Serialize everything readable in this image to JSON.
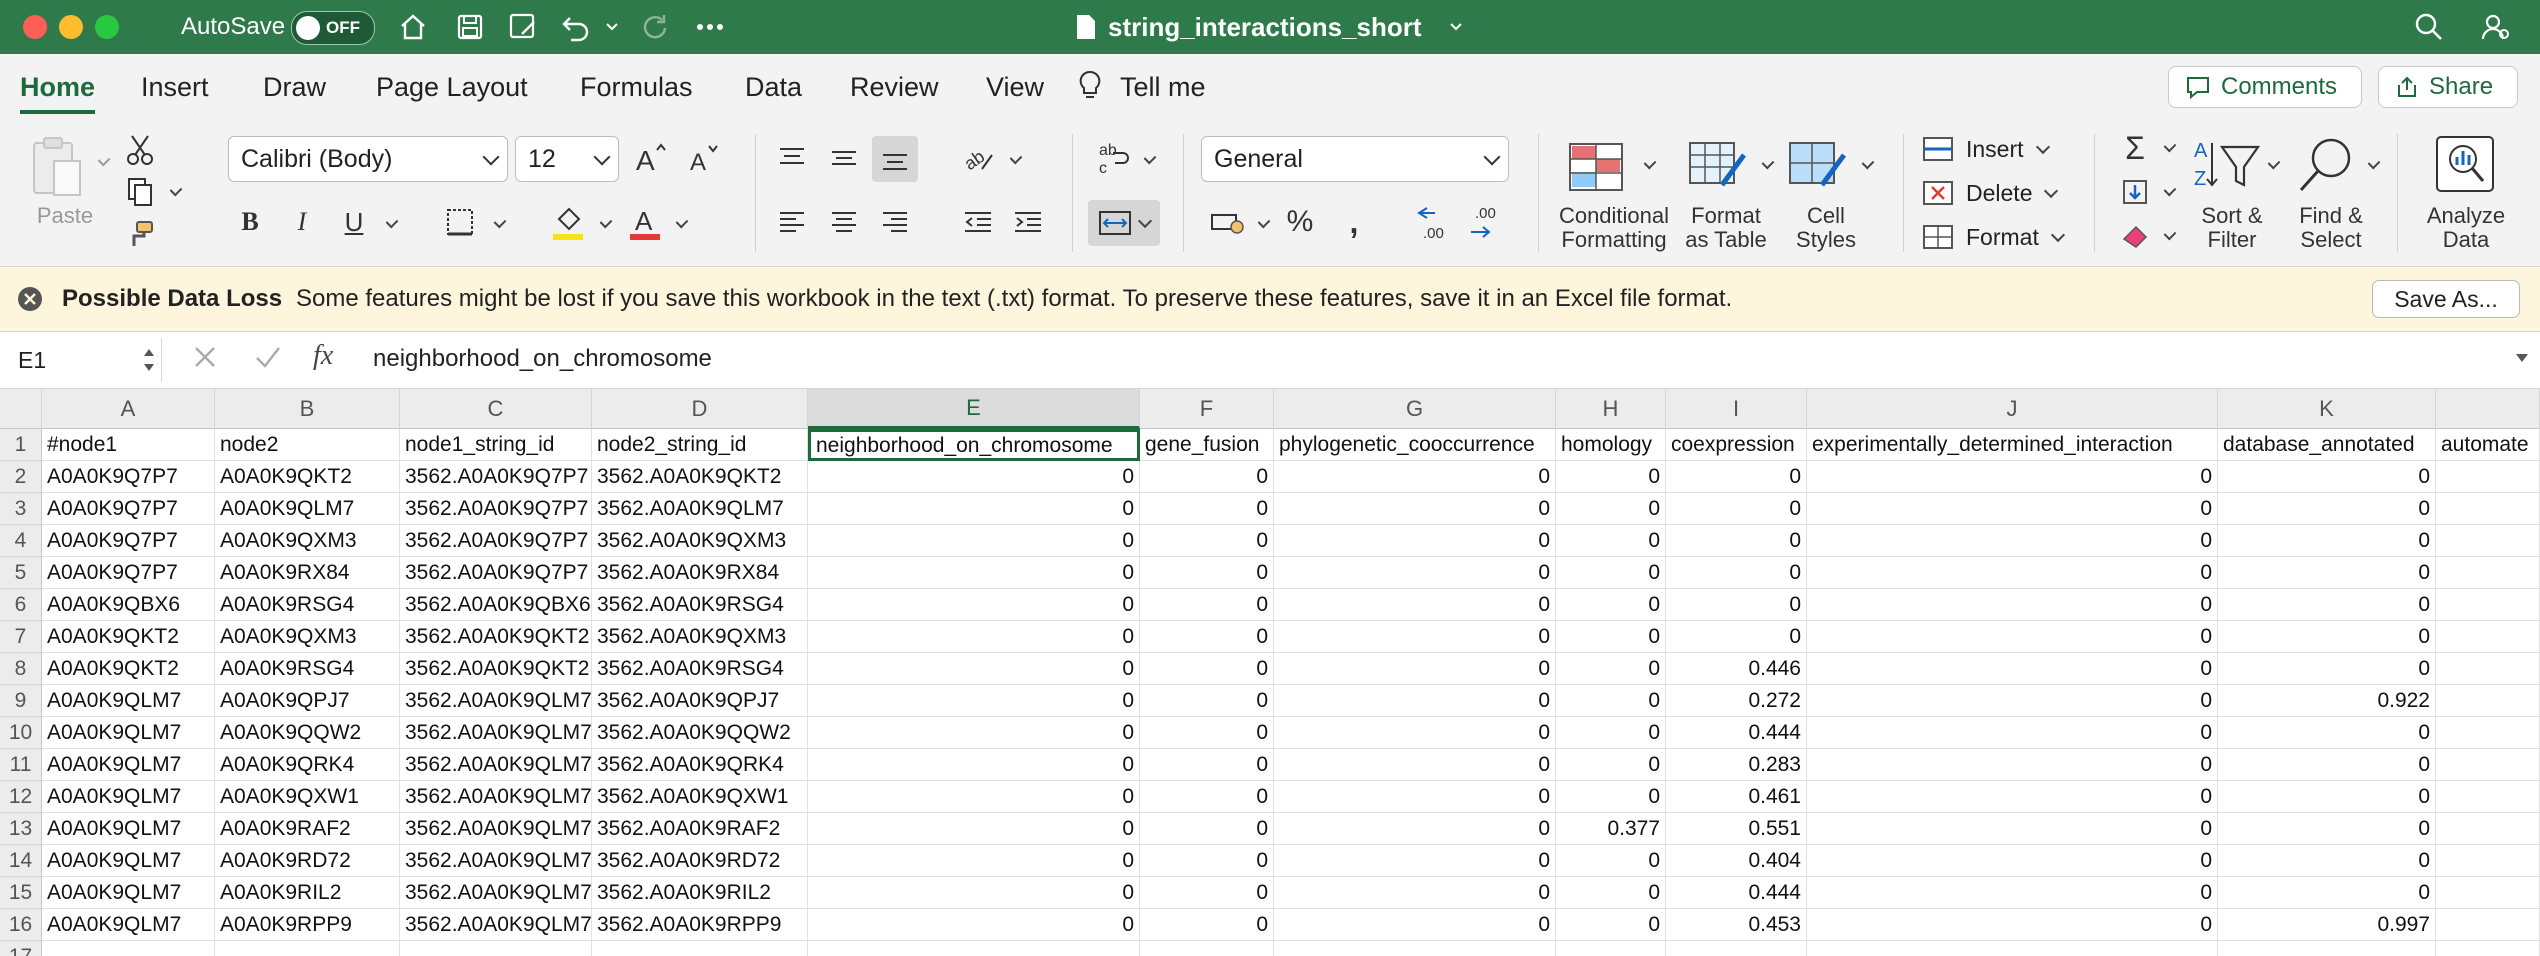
{
  "window": {
    "autosave_label": "AutoSave",
    "autosave_state": "OFF",
    "document_title": "string_interactions_short"
  },
  "tabs": [
    "Home",
    "Insert",
    "Draw",
    "Page Layout",
    "Formulas",
    "Data",
    "Review",
    "View"
  ],
  "tell_me": "Tell me",
  "comments_label": "Comments",
  "share_label": "Share",
  "ribbon": {
    "paste": "Paste",
    "font_name": "Calibri (Body)",
    "font_size": "12",
    "number_format": "General",
    "conditional_formatting": [
      "Conditional",
      "Formatting"
    ],
    "format_as_table": [
      "Format",
      "as Table"
    ],
    "cell_styles": [
      "Cell",
      "Styles"
    ],
    "insert": "Insert",
    "delete": "Delete",
    "format": "Format",
    "sort_filter": [
      "Sort &",
      "Filter"
    ],
    "find_select": [
      "Find &",
      "Select"
    ],
    "analyze_data": [
      "Analyze",
      "Data"
    ]
  },
  "warning": {
    "title": "Possible Data Loss",
    "message": "Some features might be lost if you save this workbook in the text (.txt) format. To preserve these features, save it in an Excel file format.",
    "button": "Save As..."
  },
  "formula_bar": {
    "name_box": "E1",
    "fx": "fx",
    "content": "neighborhood_on_chromosome"
  },
  "sheet": {
    "columns": [
      "A",
      "B",
      "C",
      "D",
      "E",
      "F",
      "G",
      "H",
      "I",
      "J",
      "K"
    ],
    "row_numbers": [
      "1",
      "2",
      "3",
      "4",
      "5",
      "6",
      "7",
      "8",
      "9",
      "10",
      "11",
      "12",
      "13",
      "14",
      "15",
      "16",
      "17"
    ],
    "header": [
      "#node1",
      "node2",
      "node1_string_id",
      "node2_string_id",
      "neighborhood_on_chromosome",
      "gene_fusion",
      "phylogenetic_cooccurrence",
      "homology",
      "coexpression",
      "experimentally_determined_interaction",
      "database_annotated",
      "automate"
    ],
    "rows": [
      [
        "A0A0K9Q7P7",
        "A0A0K9QKT2",
        "3562.A0A0K9Q7P7",
        "3562.A0A0K9QKT2",
        "0",
        "0",
        "0",
        "0",
        "0",
        "0",
        "0",
        ""
      ],
      [
        "A0A0K9Q7P7",
        "A0A0K9QLM7",
        "3562.A0A0K9Q7P7",
        "3562.A0A0K9QLM7",
        "0",
        "0",
        "0",
        "0",
        "0",
        "0",
        "0",
        ""
      ],
      [
        "A0A0K9Q7P7",
        "A0A0K9QXM3",
        "3562.A0A0K9Q7P7",
        "3562.A0A0K9QXM3",
        "0",
        "0",
        "0",
        "0",
        "0",
        "0",
        "0",
        ""
      ],
      [
        "A0A0K9Q7P7",
        "A0A0K9RX84",
        "3562.A0A0K9Q7P7",
        "3562.A0A0K9RX84",
        "0",
        "0",
        "0",
        "0",
        "0",
        "0",
        "0",
        ""
      ],
      [
        "A0A0K9QBX6",
        "A0A0K9RSG4",
        "3562.A0A0K9QBX6",
        "3562.A0A0K9RSG4",
        "0",
        "0",
        "0",
        "0",
        "0",
        "0",
        "0",
        ""
      ],
      [
        "A0A0K9QKT2",
        "A0A0K9QXM3",
        "3562.A0A0K9QKT2",
        "3562.A0A0K9QXM3",
        "0",
        "0",
        "0",
        "0",
        "0",
        "0",
        "0",
        ""
      ],
      [
        "A0A0K9QKT2",
        "A0A0K9RSG4",
        "3562.A0A0K9QKT2",
        "3562.A0A0K9RSG4",
        "0",
        "0",
        "0",
        "0",
        "0.446",
        "0",
        "0",
        ""
      ],
      [
        "A0A0K9QLM7",
        "A0A0K9QPJ7",
        "3562.A0A0K9QLM7",
        "3562.A0A0K9QPJ7",
        "0",
        "0",
        "0",
        "0",
        "0.272",
        "0",
        "0.922",
        ""
      ],
      [
        "A0A0K9QLM7",
        "A0A0K9QQW2",
        "3562.A0A0K9QLM7",
        "3562.A0A0K9QQW2",
        "0",
        "0",
        "0",
        "0",
        "0.444",
        "0",
        "0",
        ""
      ],
      [
        "A0A0K9QLM7",
        "A0A0K9QRK4",
        "3562.A0A0K9QLM7",
        "3562.A0A0K9QRK4",
        "0",
        "0",
        "0",
        "0",
        "0.283",
        "0",
        "0",
        ""
      ],
      [
        "A0A0K9QLM7",
        "A0A0K9QXW1",
        "3562.A0A0K9QLM7",
        "3562.A0A0K9QXW1",
        "0",
        "0",
        "0",
        "0",
        "0.461",
        "0",
        "0",
        ""
      ],
      [
        "A0A0K9QLM7",
        "A0A0K9RAF2",
        "3562.A0A0K9QLM7",
        "3562.A0A0K9RAF2",
        "0",
        "0",
        "0",
        "0.377",
        "0.551",
        "0",
        "0",
        ""
      ],
      [
        "A0A0K9QLM7",
        "A0A0K9RD72",
        "3562.A0A0K9QLM7",
        "3562.A0A0K9RD72",
        "0",
        "0",
        "0",
        "0",
        "0.404",
        "0",
        "0",
        ""
      ],
      [
        "A0A0K9QLM7",
        "A0A0K9RIL2",
        "3562.A0A0K9QLM7",
        "3562.A0A0K9RIL2",
        "0",
        "0",
        "0",
        "0",
        "0.444",
        "0",
        "0",
        ""
      ],
      [
        "A0A0K9QLM7",
        "A0A0K9RPP9",
        "3562.A0A0K9QLM7",
        "3562.A0A0K9RPP9",
        "0",
        "0",
        "0",
        "0",
        "0.453",
        "0",
        "0.997",
        ""
      ]
    ]
  },
  "colors": {
    "excel_green": "#2e7a4b",
    "accent": "#1d6a3c",
    "warning_bg": "#fdf5dc"
  }
}
